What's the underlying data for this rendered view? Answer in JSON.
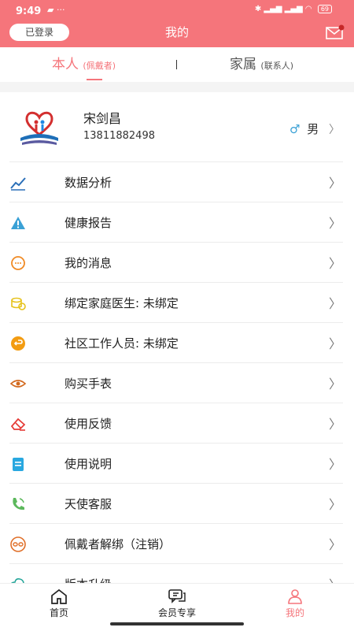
{
  "status_bar": {
    "time": "9:49",
    "battery": "69"
  },
  "header": {
    "login_badge": "已登录",
    "title": "我的"
  },
  "tabs": [
    {
      "label": "本人",
      "sub": "(佩戴者)"
    },
    {
      "label": "家属",
      "sub": "(联系人)"
    }
  ],
  "profile": {
    "name": "宋剑昌",
    "phone": "13811882498",
    "gender": "男"
  },
  "menu": [
    {
      "label": "数据分析",
      "icon": "chart-line-icon",
      "color": "#2a6fb8"
    },
    {
      "label": "健康报告",
      "icon": "warning-icon",
      "color": "#3aa1d6"
    },
    {
      "label": "我的消息",
      "icon": "chat-icon",
      "color": "#f08a24"
    },
    {
      "label": "绑定家庭医生: 未绑定",
      "icon": "coins-icon",
      "color": "#e6c21c"
    },
    {
      "label": "社区工作人员: 未绑定",
      "icon": "return-icon",
      "color": "#f39c12"
    },
    {
      "label": "购买手表",
      "icon": "eye-icon",
      "color": "#d2691e"
    },
    {
      "label": "使用反馈",
      "icon": "eraser-icon",
      "color": "#e53935"
    },
    {
      "label": "使用说明",
      "icon": "document-icon",
      "color": "#29a8e0"
    },
    {
      "label": "天使客服",
      "icon": "phone-icon",
      "color": "#5cb85c"
    },
    {
      "label": "佩戴者解绑（注销）",
      "icon": "unlink-icon",
      "color": "#e0702a"
    },
    {
      "label": "版本升级",
      "icon": "cloud-upload-icon",
      "color": "#26a69a"
    }
  ],
  "bottom_nav": [
    {
      "label": "首页",
      "icon": "home-icon"
    },
    {
      "label": "会员专享",
      "icon": "member-icon"
    },
    {
      "label": "我的",
      "icon": "profile-icon"
    }
  ],
  "colors": {
    "accent": "#f5757b"
  }
}
